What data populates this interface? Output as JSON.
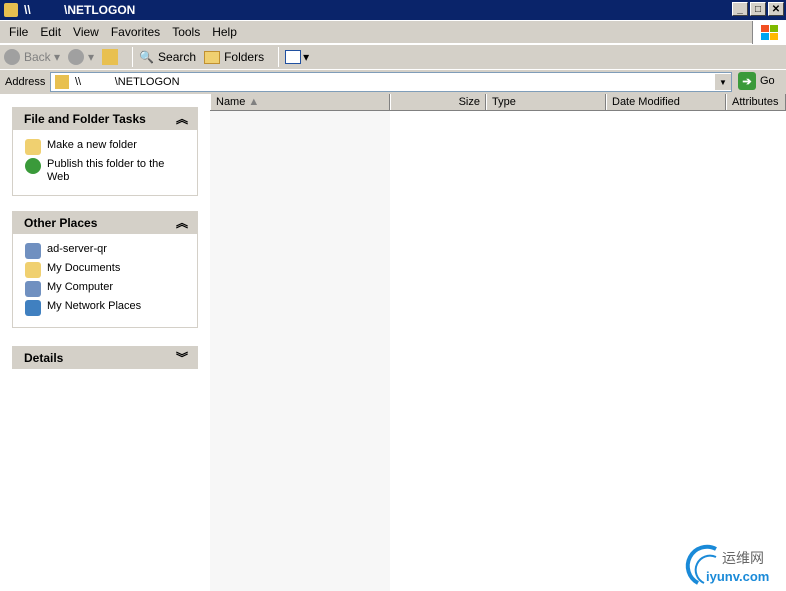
{
  "window": {
    "title": "\\\\          \\NETLOGON"
  },
  "menu": [
    "File",
    "Edit",
    "View",
    "Favorites",
    "Tools",
    "Help"
  ],
  "toolbar": {
    "back": "Back",
    "search": "Search",
    "folders": "Folders"
  },
  "address": {
    "label": "Address",
    "value": "\\\\           \\NETLOGON",
    "go": "Go"
  },
  "tasks": {
    "title": "File and Folder Tasks",
    "items": [
      "Make a new folder",
      "Publish this folder to the Web"
    ]
  },
  "places": {
    "title": "Other Places",
    "items": [
      "ad-server-qr",
      "My Documents",
      "My Computer",
      "My Network Places"
    ]
  },
  "details": {
    "title": "Details"
  },
  "columns": [
    "Name",
    "Size",
    "Type",
    "Date Modified",
    "Attributes"
  ],
  "watermark": {
    "text": "运维网 iyunv.com"
  }
}
